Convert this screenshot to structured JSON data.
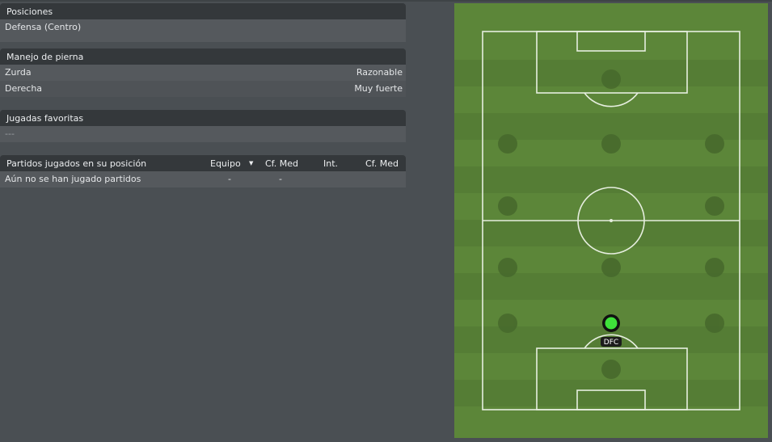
{
  "positions": {
    "header": "Posiciones",
    "rows": [
      {
        "label": "Defensa (Centro)"
      }
    ]
  },
  "foot": {
    "header": "Manejo de pierna",
    "rows": [
      {
        "label": "Zurda",
        "value": "Razonable"
      },
      {
        "label": "Derecha",
        "value": "Muy fuerte"
      }
    ]
  },
  "moves": {
    "header": "Jugadas favoritas",
    "empty": "---"
  },
  "matches": {
    "header": "Partidos jugados en su posición",
    "columns": [
      "Equipo",
      "Cf. Med",
      "Int.",
      "Cf. Med"
    ],
    "sort_icon": "sort-desc-icon",
    "row": {
      "label": "Aún no se han jugado partidos",
      "team": "-",
      "rating": "-"
    }
  },
  "pitch": {
    "player_label": "DFC",
    "player_color": "#3fe23a",
    "grass_light": "#5f8a3c",
    "grass_dark": "#557d35"
  }
}
